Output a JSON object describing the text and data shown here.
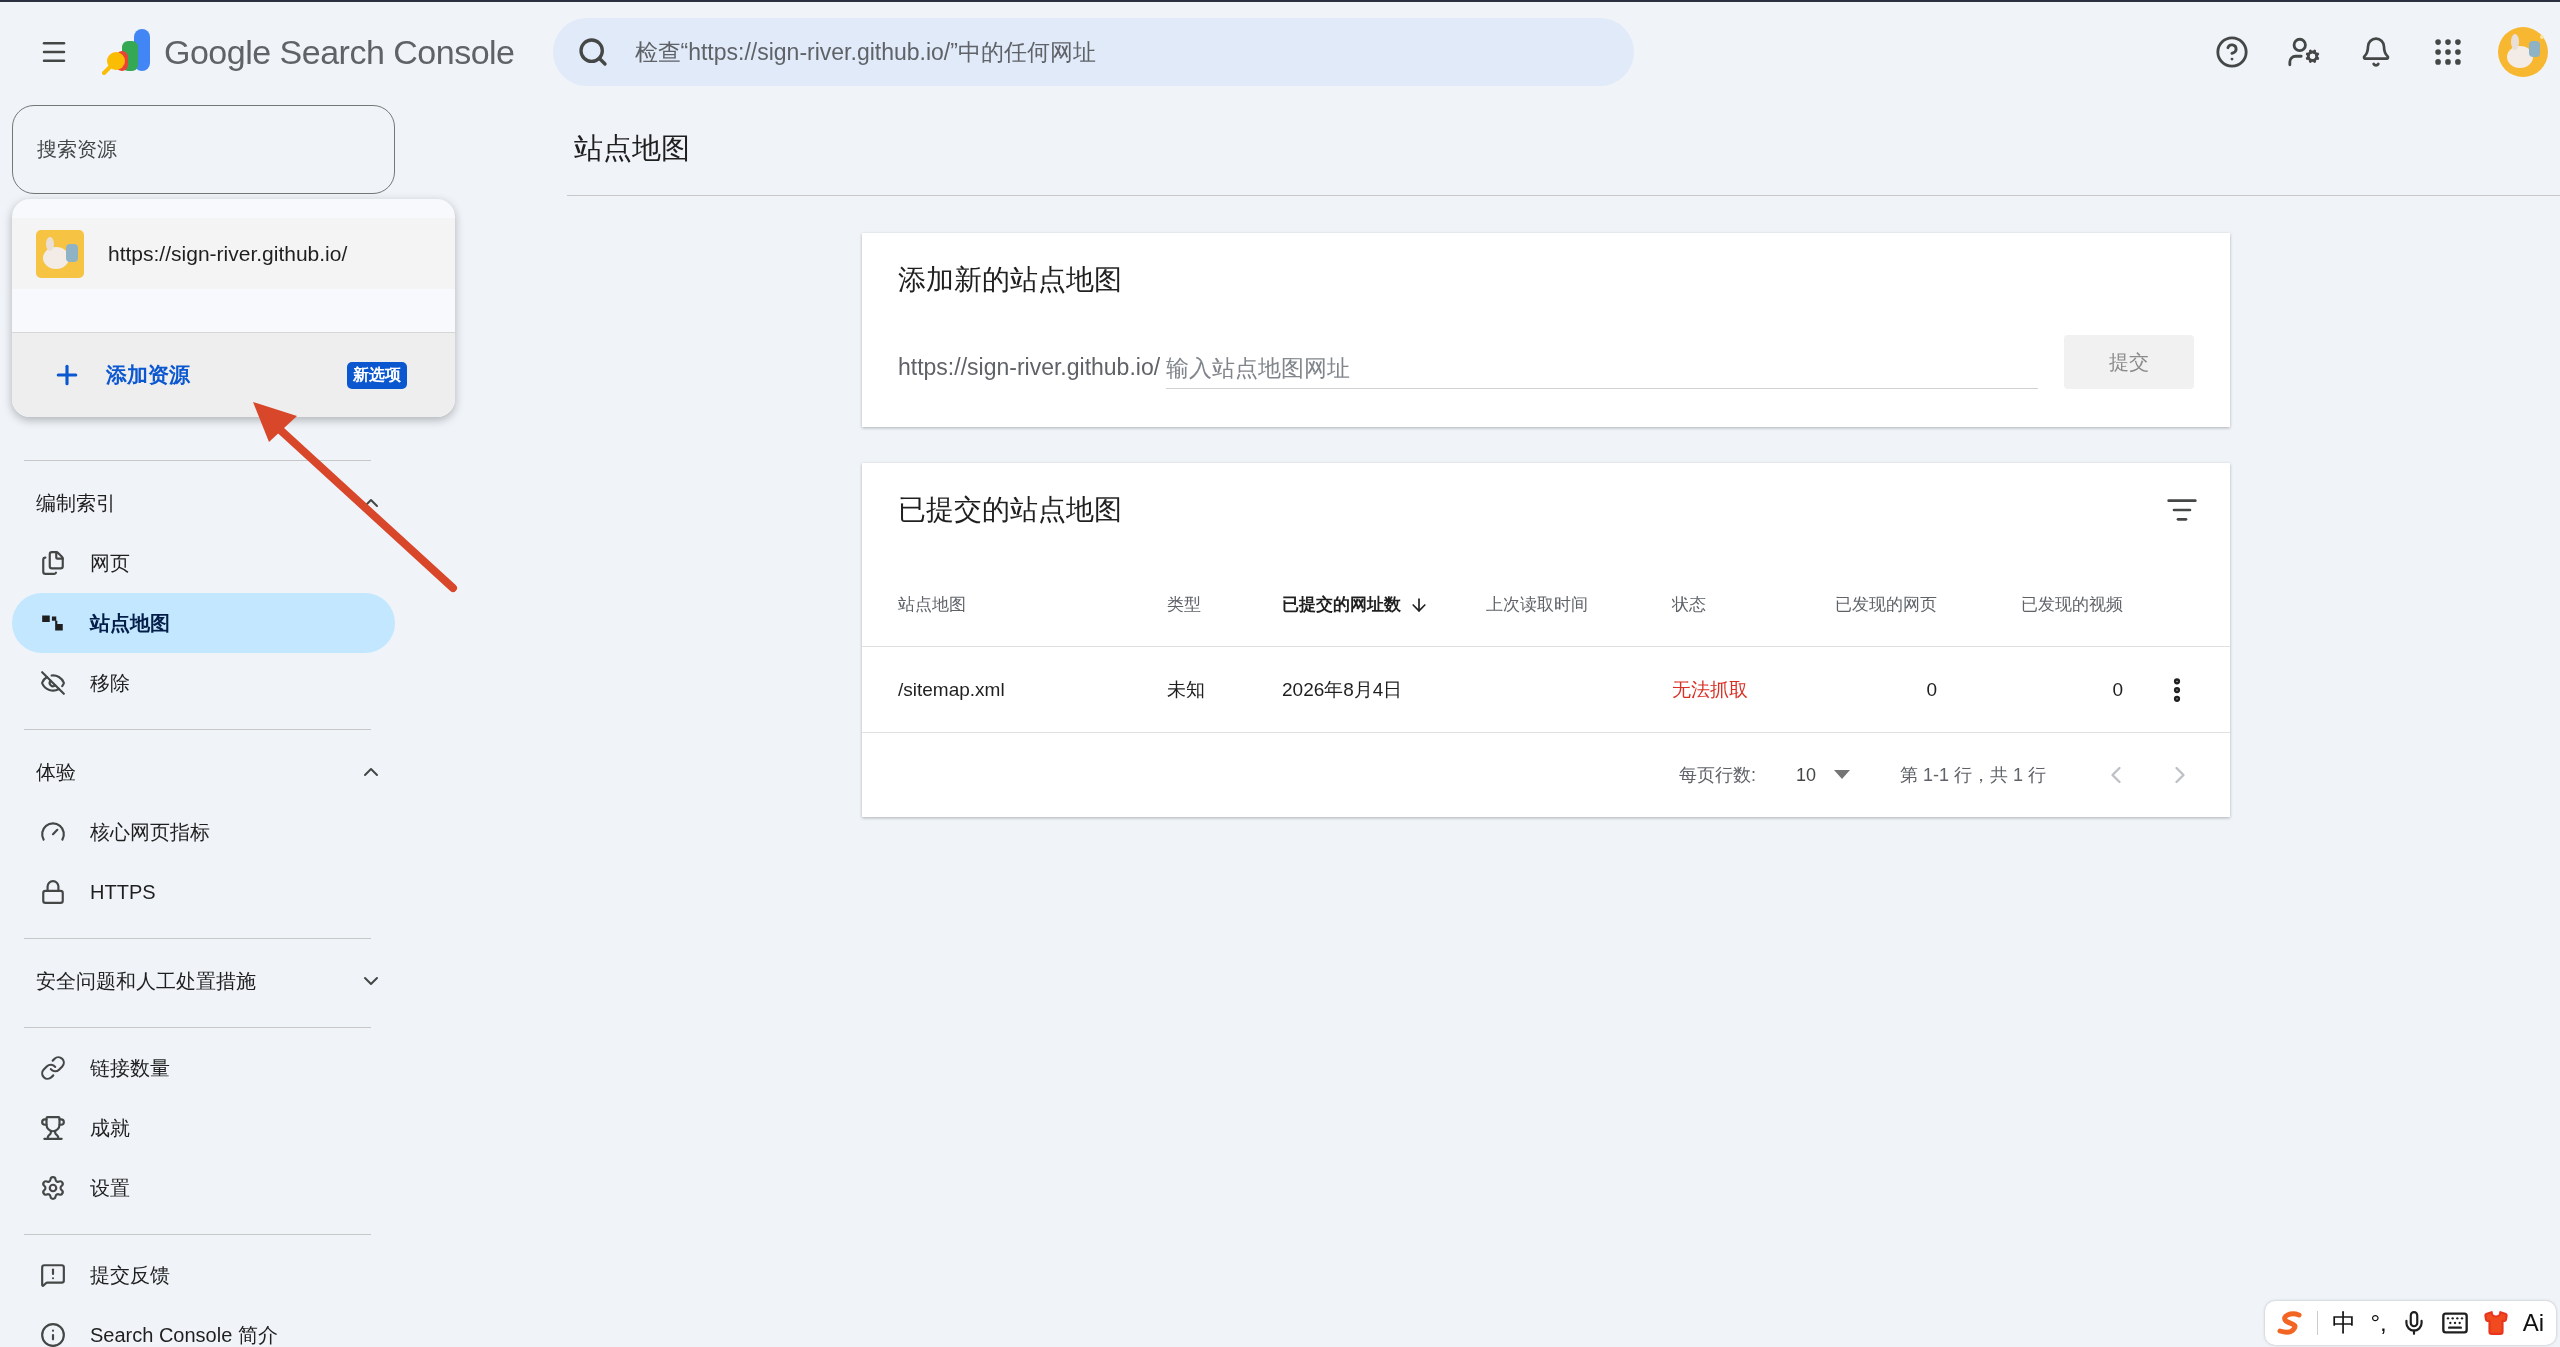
{
  "header": {
    "product_name": "Google Search Console",
    "search": {
      "placeholder": "检查“https://sign-river.github.io/”中的任何网址"
    }
  },
  "sidebar": {
    "property_search": {
      "placeholder": "搜索资源"
    },
    "property_menu": {
      "properties": [
        {
          "url": "https://sign-river.github.io/"
        }
      ],
      "add_property": {
        "label": "添加资源",
        "badge": "新选项"
      }
    },
    "sections": [
      {
        "heading": "编制索引",
        "expanded": true,
        "items": [
          {
            "label": "网页",
            "selected": false
          },
          {
            "label": "站点地图",
            "selected": true
          },
          {
            "label": "移除",
            "selected": false
          }
        ]
      },
      {
        "heading": "体验",
        "expanded": true,
        "items": [
          {
            "label": "核心网页指标",
            "selected": false
          },
          {
            "label": "HTTPS",
            "selected": false
          }
        ]
      },
      {
        "heading": "安全问题和人工处置措施",
        "expanded": false
      },
      {
        "items": [
          {
            "label": "链接数量",
            "selected": false
          },
          {
            "label": "成就",
            "selected": false
          },
          {
            "label": "设置",
            "selected": false
          }
        ]
      },
      {
        "items": [
          {
            "label": "提交反馈",
            "selected": false
          },
          {
            "label": "Search Console 简介",
            "selected": false
          }
        ]
      }
    ]
  },
  "page_title": "站点地图",
  "add_sitemap": {
    "title": "添加新的站点地图",
    "prefix": "https://sign-river.github.io/",
    "placeholder": "输入站点地图网址",
    "button": {
      "label": "提交",
      "disabled": true
    }
  },
  "submitted_sitemaps": {
    "title": "已提交的站点地图",
    "columns": [
      {
        "label": "站点地图",
        "sorted": false
      },
      {
        "label": "类型",
        "sorted": false
      },
      {
        "label": "已提交的网址数",
        "sorted": true
      },
      {
        "label": "上次读取时间",
        "sorted": false
      },
      {
        "label": "状态",
        "sorted": false
      },
      {
        "label": "已发现的网页",
        "sorted": false
      },
      {
        "label": "已发现的视频",
        "sorted": false
      }
    ],
    "rows": [
      {
        "sitemap": "/sitemap.xml",
        "type": "未知",
        "submitted": "2026年8月4日",
        "status": "无法抓取",
        "error": true,
        "pages": "0",
        "videos": "0"
      }
    ],
    "pagination": {
      "rows_per_page_label": "每页行数:",
      "rows_per_page": "10",
      "range": "第 1-1 行，共 1 行",
      "prev_disabled": true,
      "next_disabled": true
    }
  },
  "ime_toolbar": {
    "mode": "中",
    "punctuation": "°,",
    "ai": "Ai"
  }
}
